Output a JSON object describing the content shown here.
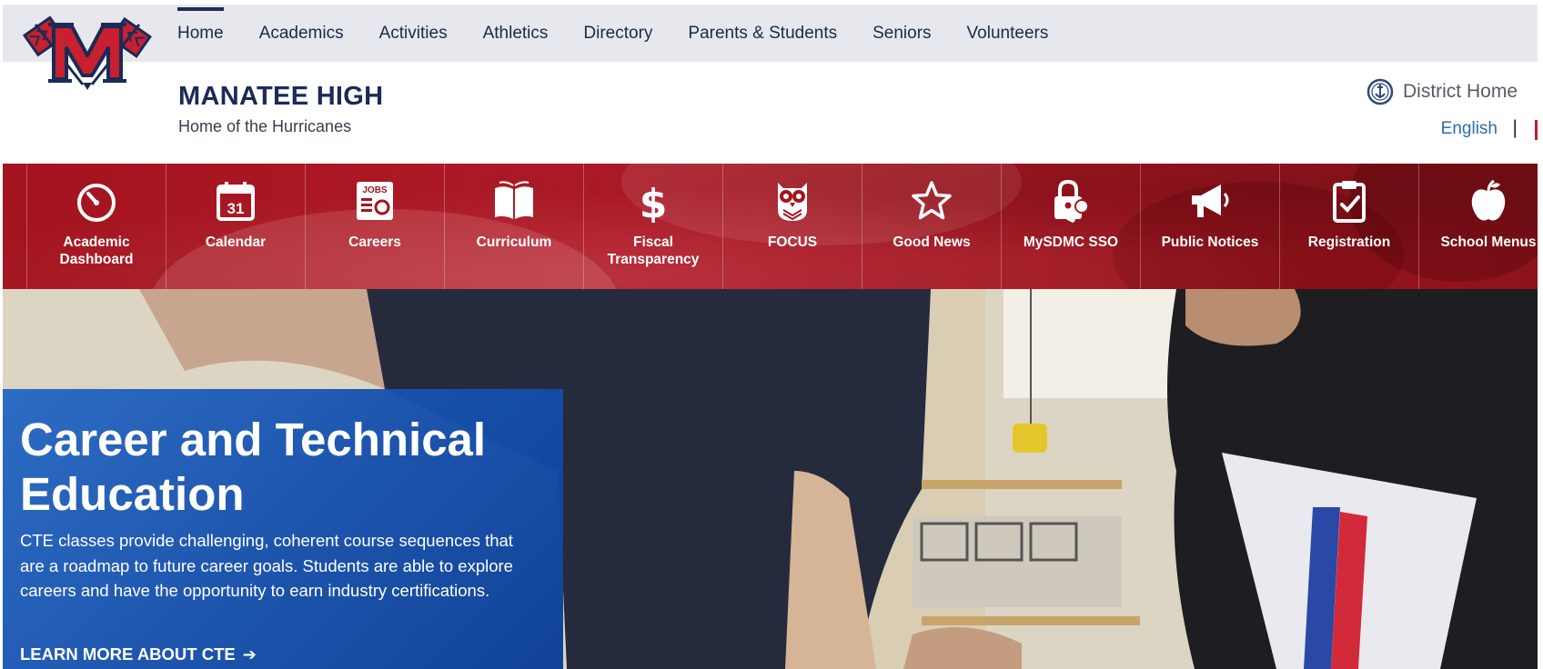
{
  "nav": {
    "items": [
      {
        "label": "Home"
      },
      {
        "label": "Academics"
      },
      {
        "label": "Activities"
      },
      {
        "label": "Athletics"
      },
      {
        "label": "Directory"
      },
      {
        "label": "Parents & Students"
      },
      {
        "label": "Seniors"
      },
      {
        "label": "Volunteers"
      }
    ],
    "active": "Home"
  },
  "logo": {
    "letter": "M"
  },
  "header": {
    "school_name": "MANATEE HIGH",
    "tagline": "Home of the Hurricanes",
    "district_label": "District Home",
    "language": "English",
    "language_separator": "|"
  },
  "quick_links": [
    {
      "label": "Academic\nDashboard",
      "icon": "gauge-icon"
    },
    {
      "label": "Calendar",
      "icon": "calendar-icon",
      "icon_text": "31"
    },
    {
      "label": "Careers",
      "icon": "jobs-newspaper-icon",
      "icon_text": "JOBS"
    },
    {
      "label": "Curriculum",
      "icon": "open-book-icon"
    },
    {
      "label": "Fiscal\nTransparency",
      "icon": "dollar-icon"
    },
    {
      "label": "FOCUS",
      "icon": "owl-icon"
    },
    {
      "label": "Good News",
      "icon": "star-icon"
    },
    {
      "label": "MySDMC SSO",
      "icon": "lock-key-icon"
    },
    {
      "label": "Public Notices",
      "icon": "megaphone-icon"
    },
    {
      "label": "Registration",
      "icon": "clipboard-check-icon"
    },
    {
      "label": "School Menus",
      "icon": "apple-icon"
    }
  ],
  "hero": {
    "title": "Career and Technical Education",
    "text": "CTE classes provide challenging, coherent course sequences that are a roadmap to future career goals. Students are able to explore careers and have the opportunity to earn industry certifications.",
    "link_label": "LEARN MORE ABOUT CTE",
    "link_arrow": "➔"
  },
  "colors": {
    "nav_bg": "#e6e8ed",
    "brand_navy": "#1b2a57",
    "brand_red": "#a3141f",
    "hero_blue": "#1f5fbb",
    "link_blue": "#2a6fb0"
  }
}
